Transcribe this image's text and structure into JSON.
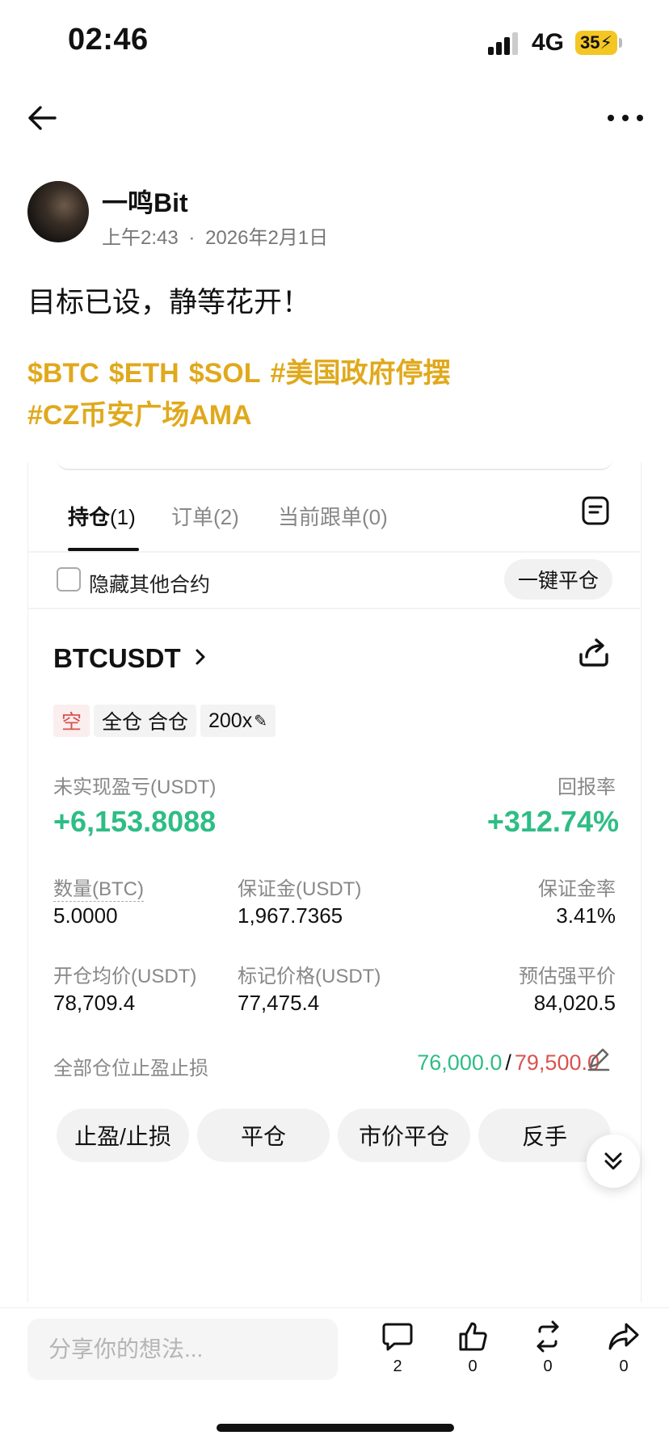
{
  "status_bar": {
    "time": "02:46",
    "network": "4G",
    "battery": "35"
  },
  "author": {
    "name": "一鸣Bit",
    "time": "上午2:43",
    "separator": "·",
    "date": "2026年2月1日"
  },
  "post": {
    "text": "目标已设，静等花开！",
    "tags": [
      "$BTC",
      "$ETH",
      "$SOL",
      "#美国政府停摆",
      "#CZ币安广场AMA"
    ]
  },
  "trade": {
    "tabs": [
      {
        "label": "持仓",
        "count": "(1)"
      },
      {
        "label": "订单",
        "count": "(2)"
      },
      {
        "label": "当前跟单",
        "count": "(0)"
      }
    ],
    "hide_others_label": "隐藏其他合约",
    "close_all_label": "一键平仓",
    "symbol": "BTCUSDT",
    "side_badge": "空",
    "margin_badge": "全仓 合仓",
    "leverage_badge": "200x",
    "unrealized_pnl_label": "未实现盈亏(USDT)",
    "unrealized_pnl": "+6,153.8088",
    "roe_label": "回报率",
    "roe": "+312.74%",
    "size_label": "数量(BTC)",
    "size": "5.0000",
    "margin_label": "保证金(USDT)",
    "margin": "1,967.7365",
    "margin_ratio_label": "保证金率",
    "margin_ratio": "3.41%",
    "entry_price_label": "开仓均价(USDT)",
    "entry_price": "78,709.4",
    "mark_price_label": "标记价格(USDT)",
    "mark_price": "77,475.4",
    "liq_price_label": "预估强平价",
    "liq_price": "84,020.5",
    "tpsl_label": "全部仓位止盈止损",
    "take_profit": "76,000.0",
    "tpsl_separator": "/",
    "stop_loss": "79,500.0",
    "actions": [
      "止盈/止损",
      "平仓",
      "市价平仓",
      "反手"
    ],
    "accent_green": "#2ebd85",
    "accent_red": "#d9534f"
  },
  "bottom_bar": {
    "comment_placeholder": "分享你的想法...",
    "comments": "2",
    "likes": "0",
    "reposts": "0",
    "shares": "0"
  },
  "icons": [
    "back-arrow-icon",
    "more-icon",
    "document-icon",
    "chevron-right-icon",
    "share-position-icon",
    "edit-icon",
    "double-chevron-down-icon",
    "comment-icon",
    "like-icon",
    "repost-icon",
    "share-icon"
  ],
  "colors": {
    "tag": "#e0a91c",
    "battery": "#f3c623"
  }
}
